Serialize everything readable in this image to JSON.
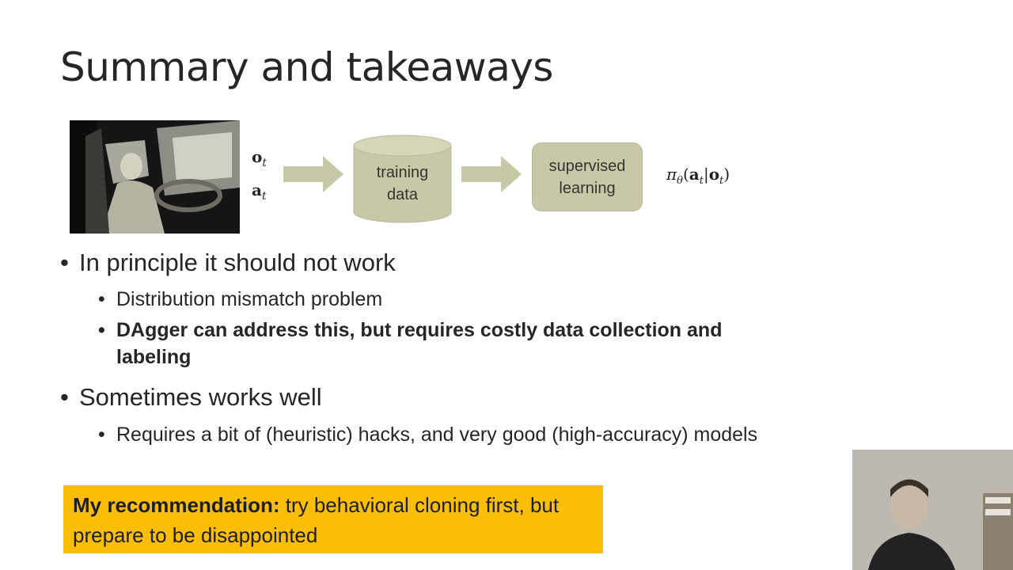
{
  "slide": {
    "title": "Summary and takeaways"
  },
  "diagram": {
    "obs_label": "o",
    "obs_sub": "t",
    "act_label": "a",
    "act_sub": "t",
    "cylinder_line1": "training",
    "cylinder_line2": "data",
    "box_line1": "supervised",
    "box_line2": "learning",
    "policy_pi": "π",
    "policy_theta": "θ",
    "policy_a": "a",
    "policy_o": "o",
    "policy_sub": "t",
    "colors": {
      "node_fill": "#c8c8a6",
      "arrow_fill": "#c8c8a6"
    }
  },
  "bullets": {
    "b1": "In principle it should not work",
    "b1_1": "Distribution mismatch problem",
    "b1_2": "DAgger can address this, but requires costly data collection and labeling",
    "b2": "Sometimes works well",
    "b2_1": "Requires a bit of (heuristic) hacks, and very good (high-accuracy) models",
    "bullet_char": "•"
  },
  "recommendation": {
    "lead": "My recommendation:",
    "text": " try behavioral cloning first, but prepare to be disappointed",
    "color": "#fbbe08"
  }
}
